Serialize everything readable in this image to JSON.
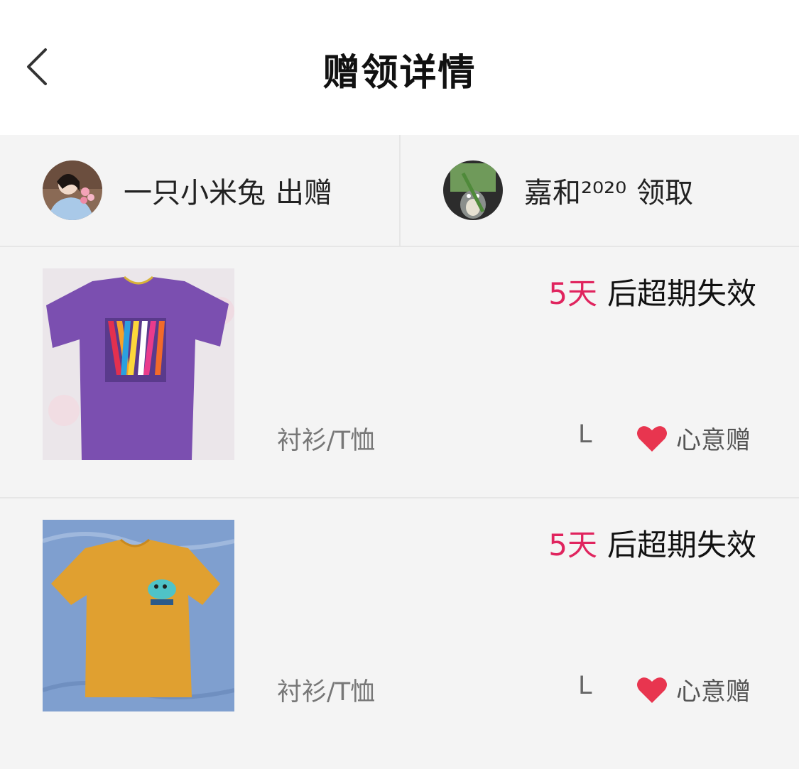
{
  "header": {
    "title": "赠领详情",
    "back_icon": "chevron-left-icon"
  },
  "parties": {
    "giver": {
      "name": "一只小米兔",
      "action": "出赠"
    },
    "receiver": {
      "name": "嘉和²⁰²⁰",
      "action": "领取"
    }
  },
  "items": [
    {
      "expire_days": "5天",
      "expire_text": "后超期失效",
      "category": "衬衫/T恤",
      "size": "L",
      "tag": "心意赠",
      "tag_icon": "heart-icon",
      "shirt_color": "#7b4fb0"
    },
    {
      "expire_days": "5天",
      "expire_text": "后超期失效",
      "category": "衬衫/T恤",
      "size": "L",
      "tag": "心意赠",
      "tag_icon": "heart-icon",
      "shirt_color": "#e0a030"
    }
  ],
  "colors": {
    "accent": "#e0245e",
    "heart": "#e8354f",
    "background": "#f4f4f4"
  }
}
